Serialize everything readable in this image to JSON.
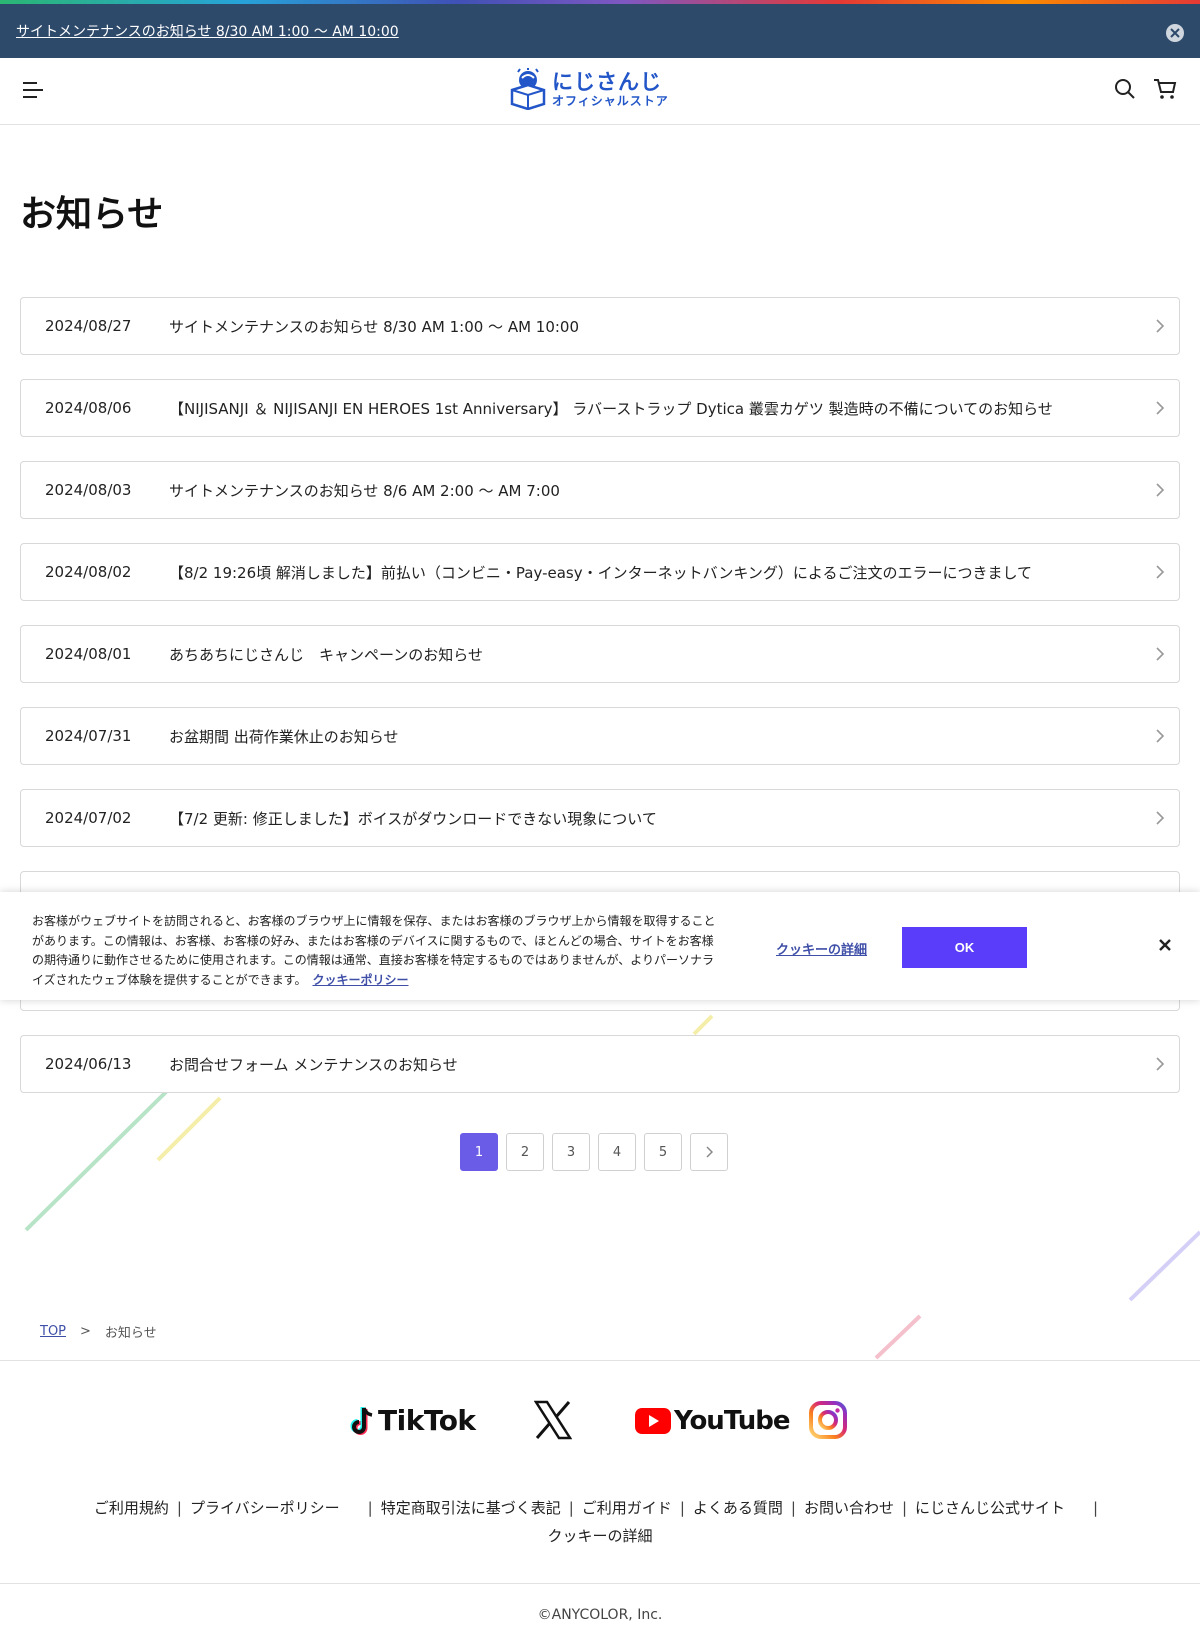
{
  "announcement": {
    "text": "サイトメンテナンスのお知らせ 8/30 AM 1:00 〜 AM 10:00"
  },
  "header": {
    "logo_main": "にじさんじ",
    "logo_sub": "オフィシャルストア"
  },
  "page": {
    "title": "お知らせ"
  },
  "news": [
    {
      "date": "2024/08/27",
      "title": "サイトメンテナンスのお知らせ 8/30 AM 1:00 〜 AM 10:00"
    },
    {
      "date": "2024/08/06",
      "title": "【NIJISANJI ＆ NIJISANJI EN HEROES 1st Anniversary】 ラバーストラップ Dytica 叢雲カゲツ 製造時の不備についてのお知らせ"
    },
    {
      "date": "2024/08/03",
      "title": "サイトメンテナンスのお知らせ 8/6 AM 2:00 〜 AM 7:00"
    },
    {
      "date": "2024/08/02",
      "title": "【8/2 19:26頃 解消しました】前払い（コンビニ・Pay-easy・インターネットバンキング）によるご注文のエラーにつきまして"
    },
    {
      "date": "2024/08/01",
      "title": "あちあちにじさんじ　キャンペーンのお知らせ"
    },
    {
      "date": "2024/07/31",
      "title": "お盆期間 出荷作業休止のお知らせ"
    },
    {
      "date": "2024/07/02",
      "title": "【7/2 更新: 修正しました】ボイスがダウンロードできない現象について"
    },
    {
      "date": "",
      "title": ""
    },
    {
      "date": "",
      "title": ""
    },
    {
      "date": "2024/06/13",
      "title": "お問合せフォーム メンテナンスのお知らせ"
    }
  ],
  "cookie_banner": {
    "text": "お客様がウェブサイトを訪問されると、お客様のブラウザ上に情報を保存、またはお客様のブラウザ上から情報を取得することがあります。この情報は、お客様、お客様の好み、またはお客様のデバイスに関するもので、ほとんどの場合、サイトをお客様の期待通りに動作させるために使用されます。この情報は通常、直接お客様を特定するものではありませんが、よりパーソナライズされたウェブ体験を提供することができます。",
    "policy_link": "クッキーポリシー",
    "detail_link": "クッキーの詳細",
    "ok_label": "OK"
  },
  "pagination": {
    "pages": [
      "1",
      "2",
      "3",
      "4",
      "5"
    ],
    "current": "1"
  },
  "breadcrumb": {
    "top": "TOP",
    "separator": ">",
    "current": "お知らせ"
  },
  "footer": {
    "social": {
      "tiktok": "TikTok",
      "youtube": "YouTube"
    },
    "links": [
      "ご利用規約",
      "プライバシーポリシー",
      "特定商取引法に基づく表記",
      "ご利用ガイド",
      "よくある質問",
      "お問い合わせ",
      "にじさんじ公式サイト"
    ],
    "links_row2": "クッキーの詳細",
    "copyright": "©ANYCOLOR, Inc."
  },
  "colors": {
    "announce_bg": "#2e4a6b",
    "accent": "#6b5ce7",
    "ok_button": "#5a3dfa",
    "logo_blue": "#2256c8"
  }
}
